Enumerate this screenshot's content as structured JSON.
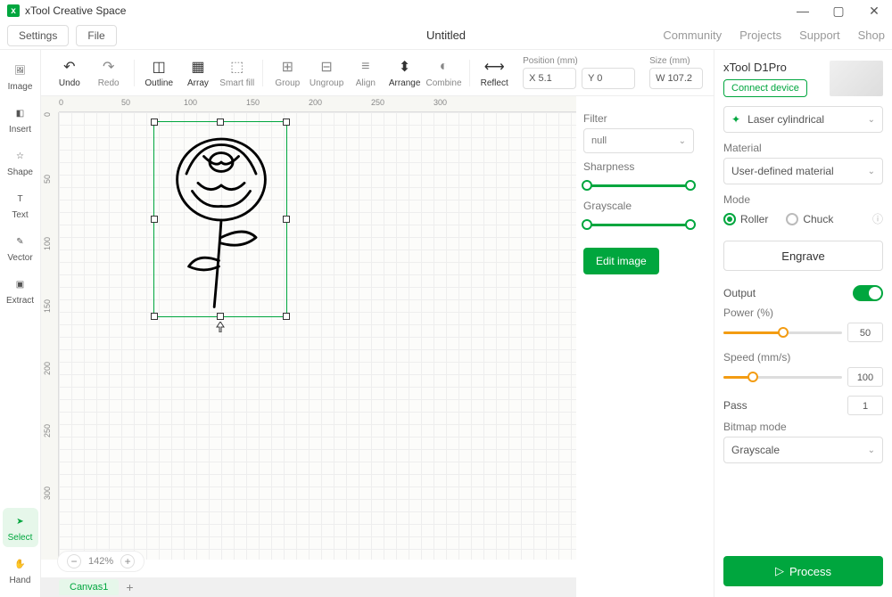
{
  "app_title": "xTool Creative Space",
  "menubar": {
    "settings": "Settings",
    "file": "File",
    "doc_title": "Untitled",
    "links": {
      "community": "Community",
      "projects": "Projects",
      "support": "Support",
      "shop": "Shop"
    }
  },
  "left_tools": {
    "image": "Image",
    "insert": "Insert",
    "shape": "Shape",
    "text": "Text",
    "vector": "Vector",
    "extract": "Extract",
    "select": "Select",
    "hand": "Hand"
  },
  "toolbar": {
    "undo": "Undo",
    "redo": "Redo",
    "outline": "Outline",
    "array": "Array",
    "smartfill": "Smart fill",
    "group": "Group",
    "ungroup": "Ungroup",
    "align": "Align",
    "arrange": "Arrange",
    "combine": "Combine",
    "reflect": "Reflect",
    "pos_label": "Position (mm)",
    "pos_x": "X  5.1",
    "pos_y": "Y  0",
    "size_label": "Size (mm)",
    "size_w": "W  107.2"
  },
  "ruler_h": [
    "0",
    "50",
    "100",
    "150",
    "200",
    "250",
    "300"
  ],
  "ruler_v": [
    "0",
    "50",
    "100",
    "150",
    "200",
    "250",
    "300"
  ],
  "zoom": "142%",
  "canvas_tab": "Canvas1",
  "edit_panel": {
    "filter": "Filter",
    "filter_val": "null",
    "sharpness": "Sharpness",
    "grayscale": "Grayscale",
    "edit_btn": "Edit image"
  },
  "right": {
    "device": "xTool D1Pro",
    "connect": "Connect device",
    "processing": "Laser cylindrical",
    "material_label": "Material",
    "material_val": "User-defined material",
    "mode_label": "Mode",
    "roller": "Roller",
    "chuck": "Chuck",
    "engrave": "Engrave",
    "output": "Output",
    "power_label": "Power (%)",
    "power_val": "50",
    "speed_label": "Speed (mm/s)",
    "speed_val": "100",
    "pass_label": "Pass",
    "pass_val": "1",
    "bitmap_label": "Bitmap mode",
    "bitmap_val": "Grayscale",
    "process": "Process"
  }
}
